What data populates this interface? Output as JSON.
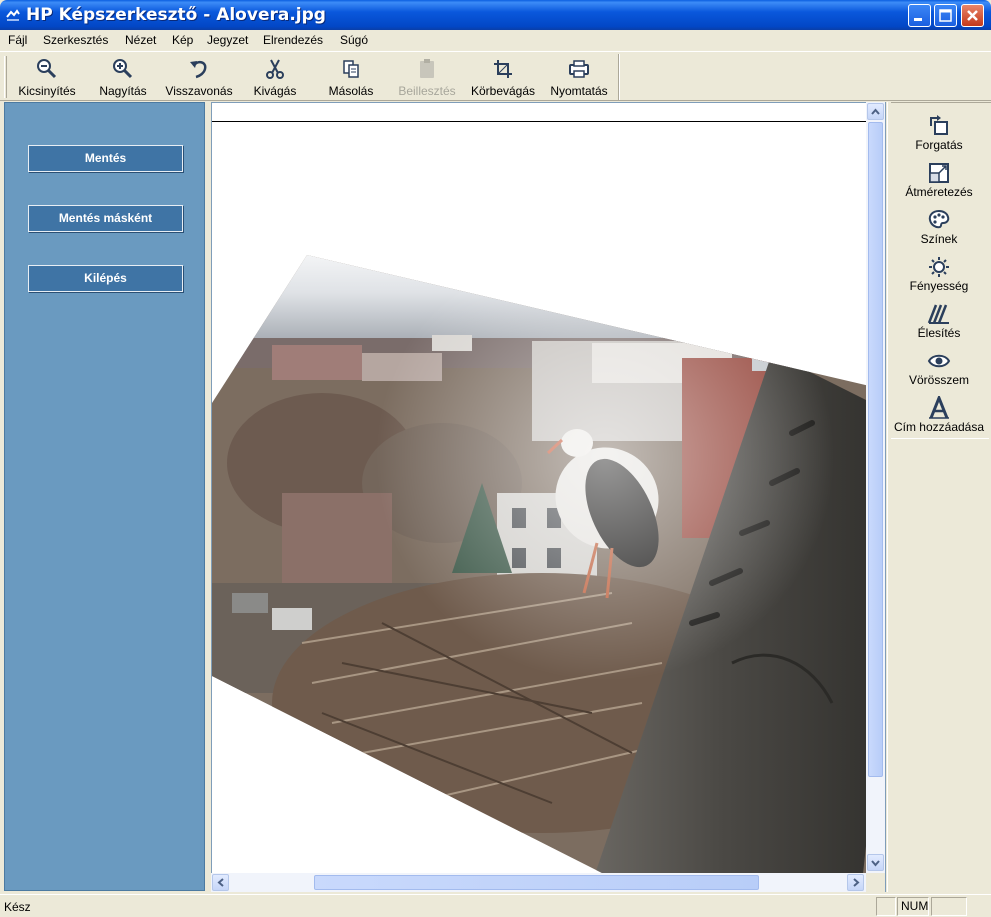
{
  "window": {
    "title": "HP Képszerkesztő - Alovera.jpg"
  },
  "menu": [
    "Fájl",
    "Szerkesztés",
    "Nézet",
    "Kép",
    "Jegyzet",
    "Elrendezés",
    "Súgó"
  ],
  "toolbar": {
    "zoom_out": "Kicsinyítés",
    "zoom_in": "Nagyítás",
    "undo": "Visszavonás",
    "cut": "Kivágás",
    "copy": "Másolás",
    "paste": "Beillesztés",
    "crop": "Körbevágás",
    "print": "Nyomtatás",
    "paste_enabled": false
  },
  "left_panel": {
    "save": "Mentés",
    "save_as": "Mentés másként",
    "exit": "Kilépés"
  },
  "right_panel": {
    "rotate": "Forgatás",
    "resize": "Átméretezés",
    "colors": "Színek",
    "brightness": "Fényesség",
    "sharpen": "Élesítés",
    "red_eye": "Vörösszem",
    "add_title": "Cím hozzáadása"
  },
  "status": {
    "text": "Kész",
    "num": "NUM"
  },
  "colors": {
    "title_bar": "#0a58dc",
    "left_panel": "#6a9ac0",
    "panel_button": "#3f74a5"
  }
}
